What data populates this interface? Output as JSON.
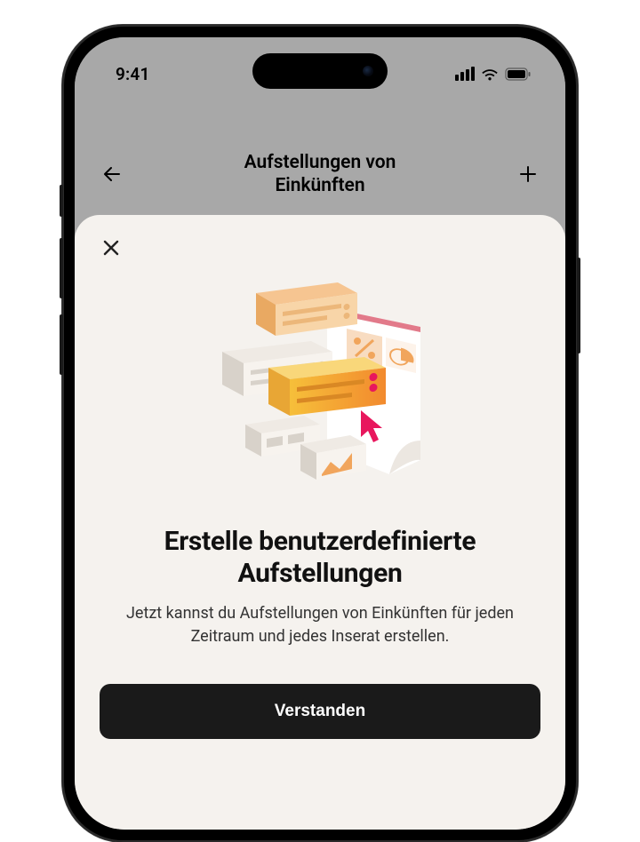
{
  "status": {
    "time": "9:41"
  },
  "nav": {
    "title_line1": "Aufstellungen von",
    "title_line2": "Einkünften"
  },
  "sheet": {
    "title": "Erstelle benutzerdefinierte Aufstellungen",
    "description": "Jetzt kannst du Aufstellungen von Einkünften für jeden Zeitraum und jedes Inserat erstellen.",
    "cta": "Verstanden"
  },
  "colors": {
    "sheet_bg": "#f5f2ee",
    "primary_btn": "#1a1a1a",
    "accent_pink": "#e8175d",
    "accent_orange": "#f5a35c"
  }
}
